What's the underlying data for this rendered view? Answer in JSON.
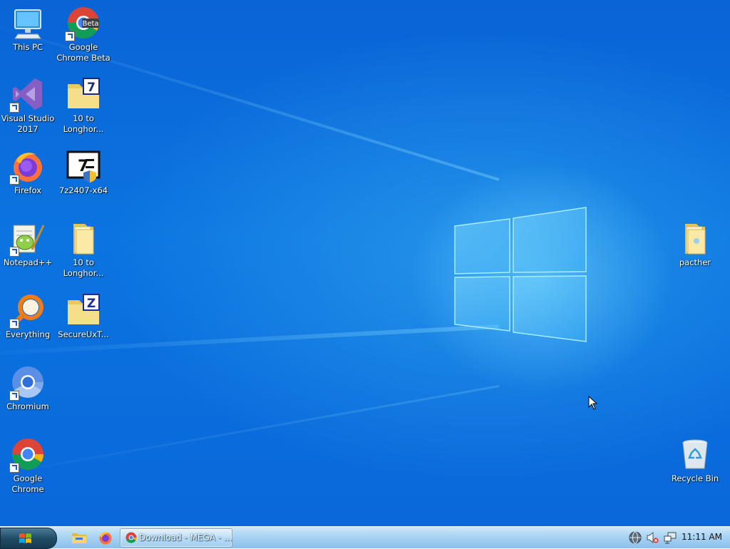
{
  "desktop_icons": [
    {
      "id": "this-pc",
      "label": "This PC",
      "icon": "computer-icon"
    },
    {
      "id": "chrome-beta",
      "label": "Google\nChrome Beta",
      "icon": "chrome-beta-icon",
      "badge": "Beta"
    },
    {
      "id": "visual-studio",
      "label": "Visual Studio\n2017",
      "icon": "visual-studio-icon"
    },
    {
      "id": "10-to-longhorn-1",
      "label": "10 to\nLonghor...",
      "icon": "archive-folder-icon"
    },
    {
      "id": "firefox",
      "label": "Firefox",
      "icon": "firefox-icon"
    },
    {
      "id": "7z-installer",
      "label": "7z2407-x64",
      "icon": "7zip-installer-icon"
    },
    {
      "id": "notepad-plus",
      "label": "Notepad++",
      "icon": "notepad-plus-icon"
    },
    {
      "id": "10-to-longhorn-2",
      "label": "10 to\nLonghor...",
      "icon": "folder-icon"
    },
    {
      "id": "everything",
      "label": "Everything",
      "icon": "everything-search-icon"
    },
    {
      "id": "secureuxt",
      "label": "SecureUxT...",
      "icon": "zip-folder-icon"
    },
    {
      "id": "chromium",
      "label": "Chromium",
      "icon": "chromium-icon"
    },
    {
      "id": "google-chrome",
      "label": "Google\nChrome",
      "icon": "chrome-icon"
    },
    {
      "id": "pacther",
      "label": "pacther",
      "icon": "folder-icon"
    },
    {
      "id": "recycle-bin",
      "label": "Recycle Bin",
      "icon": "recycle-bin-icon"
    }
  ],
  "taskbar": {
    "start_icon": "windows-orb-icon",
    "quick_launch": [
      {
        "name": "file-explorer",
        "icon": "folder-icon"
      },
      {
        "name": "firefox",
        "icon": "firefox-icon"
      }
    ],
    "active_task": {
      "label": "Download - MEGA - ...",
      "icon": "chrome-icon"
    },
    "tray": [
      {
        "name": "network-globe",
        "icon": "globe-icon"
      },
      {
        "name": "volume",
        "icon": "speaker-muted-icon"
      },
      {
        "name": "network",
        "icon": "network-icon"
      }
    ],
    "clock": "11:11 AM"
  },
  "colors": {
    "accent": "#0a6ad8",
    "taskbar": "#a9d3f3"
  }
}
